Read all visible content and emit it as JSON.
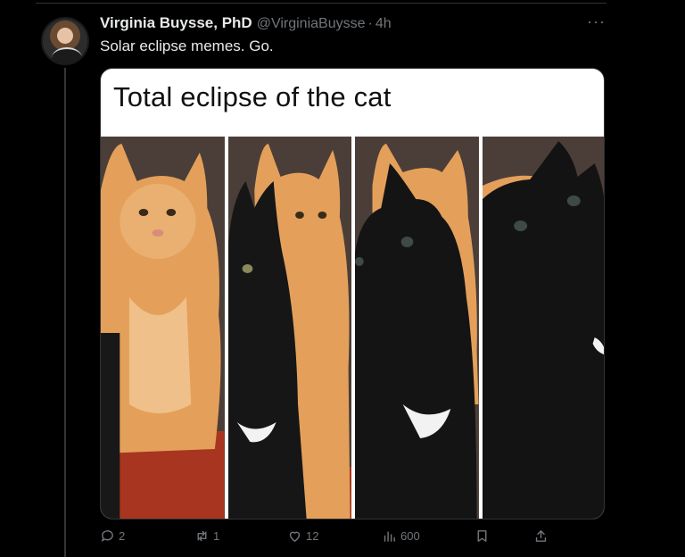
{
  "tweet": {
    "author_name": "Virginia Buysse, PhD",
    "author_handle": "@VirginiaBuysse",
    "separator": "·",
    "time": "4h",
    "more": "···",
    "text": "Solar eclipse memes. Go."
  },
  "media": {
    "meme_title": "Total eclipse of the cat"
  },
  "actions": {
    "replies": "2",
    "retweets": "1",
    "likes": "12",
    "views": "600"
  },
  "colors": {
    "background": "#000000",
    "primary_text": "#e7e9ea",
    "secondary_text": "#71767b",
    "orange_cat": "#e4a05a",
    "black_cat": "#161616"
  }
}
